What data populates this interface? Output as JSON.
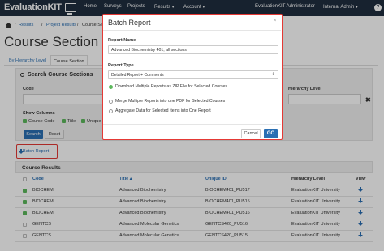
{
  "navbar": {
    "brand": "EvaluationKIT",
    "items": [
      "Home",
      "Surveys",
      "Projects",
      "Results ▾",
      "Account ▾"
    ],
    "admin_label": "EvaluationKIT Administrator",
    "internal_admin": "Internal Admin ▾",
    "help": "?"
  },
  "breadcrumb": {
    "items": [
      "Results",
      "/",
      "Project Results",
      "/",
      "Course Se"
    ]
  },
  "page": {
    "title": "Course Section Re"
  },
  "tabs": [
    "By Hierarchy Level",
    "Course Section"
  ],
  "search_panel": {
    "title": "Search Course Sections",
    "code_label": "Code",
    "hierarchy_label": "Hierarchy Level",
    "clear": "✖",
    "show_columns_label": "Show Columns",
    "columns": [
      "Course Code",
      "Title",
      "Unique ID"
    ],
    "search_button": "Search",
    "reset_button": "Reset"
  },
  "batch_report_button": "Batch Report",
  "results": {
    "title": "Course Results",
    "columns": [
      "Code",
      "Title ▴",
      "Unique ID",
      "Hierarchy Level",
      "View"
    ],
    "rows": [
      {
        "code": "BIOCHEM",
        "title": "Advanced Biochemistry",
        "unique_id": "BIOCHEM401_PU517",
        "hierarchy": "EvaluationKIT University",
        "checked": true
      },
      {
        "code": "BIOCHEM",
        "title": "Advanced Biochemistry",
        "unique_id": "BIOCHEM401_PU515",
        "hierarchy": "EvaluationKIT University",
        "checked": true
      },
      {
        "code": "BIOCHEM",
        "title": "Advanced Biochemistry",
        "unique_id": "BIOCHEM401_PU516",
        "hierarchy": "EvaluationKIT University",
        "checked": true
      },
      {
        "code": "GENTCS",
        "title": "Advanced Molecular Genetics",
        "unique_id": "GENTCS420_PU516",
        "hierarchy": "EvaluationKIT University",
        "checked": false
      },
      {
        "code": "GENTCS",
        "title": "Advanced Molecular Genetics",
        "unique_id": "GENTCS420_PU515",
        "hierarchy": "EvaluationKIT University",
        "checked": false
      }
    ]
  },
  "modal": {
    "title": "Batch Report",
    "close": "×",
    "report_name_label": "Report Name",
    "report_name_value": "Advanced Biochemistry 401, all sections",
    "report_type_label": "Report Type",
    "report_type_value": "Detailed Report + Comments",
    "options": [
      {
        "label": "Download Multiple Reports as ZIP File for Selected Courses",
        "selected": true
      },
      {
        "label": "Merge Multiple Reports into one PDF for Selected Courses",
        "selected": false
      },
      {
        "label": "Aggregate Data for Selected Items into One Report",
        "selected": false
      }
    ],
    "cancel_button": "Cancel",
    "go_button": "GO"
  },
  "colors": {
    "navbar": "#1f2e3f",
    "link": "#2a6fb3",
    "highlight": "#e53935",
    "check": "#5cb85c"
  }
}
